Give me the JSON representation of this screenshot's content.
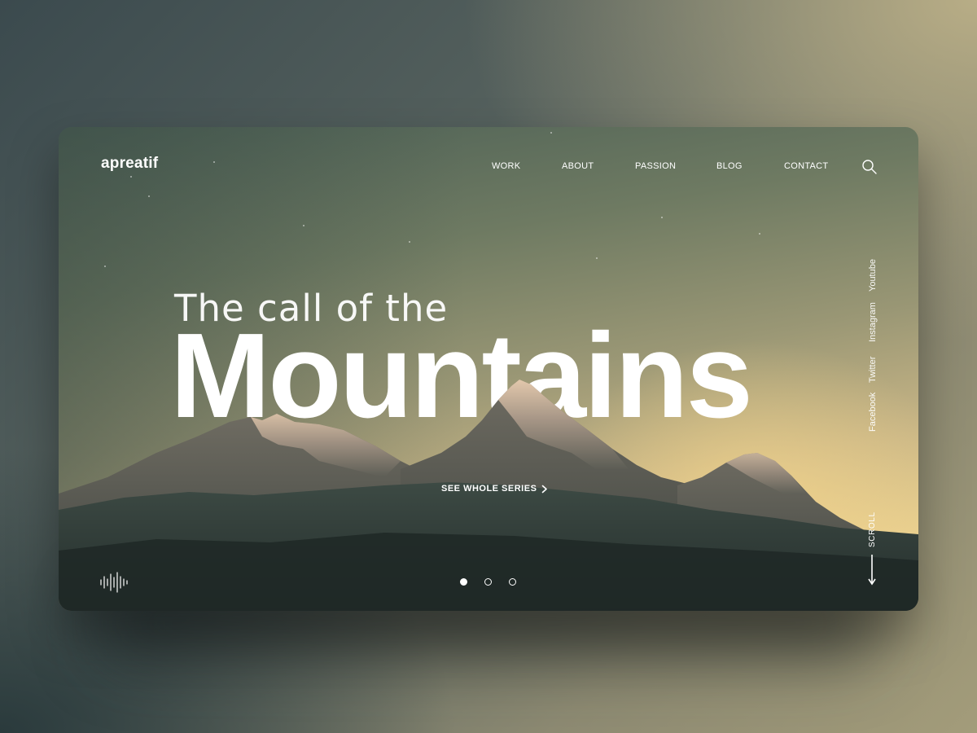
{
  "brand": {
    "logo": "apreatif"
  },
  "nav": {
    "items": [
      {
        "label": "WORK"
      },
      {
        "label": "ABOUT"
      },
      {
        "label": "PASSION"
      },
      {
        "label": "BLOG"
      },
      {
        "label": "CONTACT"
      }
    ],
    "search_icon": "search-icon"
  },
  "hero": {
    "subtitle": "The call of the",
    "title": "Mountains",
    "cta_label": "SEE WHOLE SERIES",
    "cta_icon": "chevron-right-icon"
  },
  "socials": [
    {
      "label": "Youtube"
    },
    {
      "label": "Instagram"
    },
    {
      "label": "Twitter"
    },
    {
      "label": "Facebook"
    }
  ],
  "scroll": {
    "label": "SCROLL",
    "icon": "arrow-down-icon"
  },
  "sound_icon": "sound-wave-icon",
  "slider": {
    "count": 3,
    "active": 1
  },
  "colors": {
    "text": "#ffffff",
    "sky_top": "#4b5f55",
    "sky_bottom": "#efd695",
    "mountain_dark": "#2b3632"
  }
}
